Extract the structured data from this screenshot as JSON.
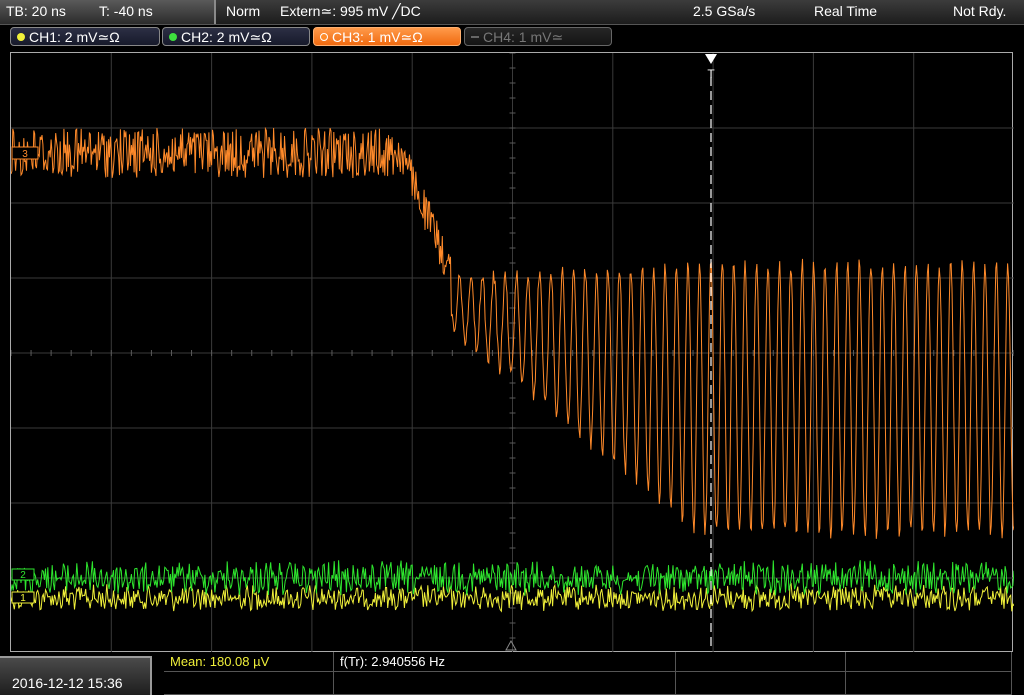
{
  "topbar": {
    "timebase": "TB: 20 ns",
    "trigger_time": "T: -40 ns",
    "trigger_mode": "Norm",
    "trigger_source": "Extern≃: 995 mV ╱DC",
    "sample_rate": "2.5 GSa/s",
    "acq_mode": "Real Time",
    "status": "Not Rdy."
  },
  "channels": [
    {
      "label": "CH1: 2 mV≃Ω",
      "color": "#f0f03a",
      "active": true
    },
    {
      "label": "CH2: 2 mV≃Ω",
      "color": "#3ee03e",
      "active": true
    },
    {
      "label": "CH3: 1 mV≃Ω",
      "color": "#ff8c2a",
      "active": true,
      "selected": true
    },
    {
      "label": "CH4: 1 mV≃",
      "color": "#777777",
      "active": false
    }
  ],
  "markers": {
    "ch3": "3",
    "ch2": "2",
    "ch1": "1",
    "trigger": "T"
  },
  "datetime": "2016-12-12 15:36",
  "measurements": {
    "mean": "Mean: 180.08 µV",
    "freq": "f(Tr): 2.940556 Hz"
  },
  "colors": {
    "ch1": "#f0f03a",
    "ch2": "#2ee62e",
    "ch3": "#ff8a2a",
    "grid": "#3a3a3a"
  }
}
